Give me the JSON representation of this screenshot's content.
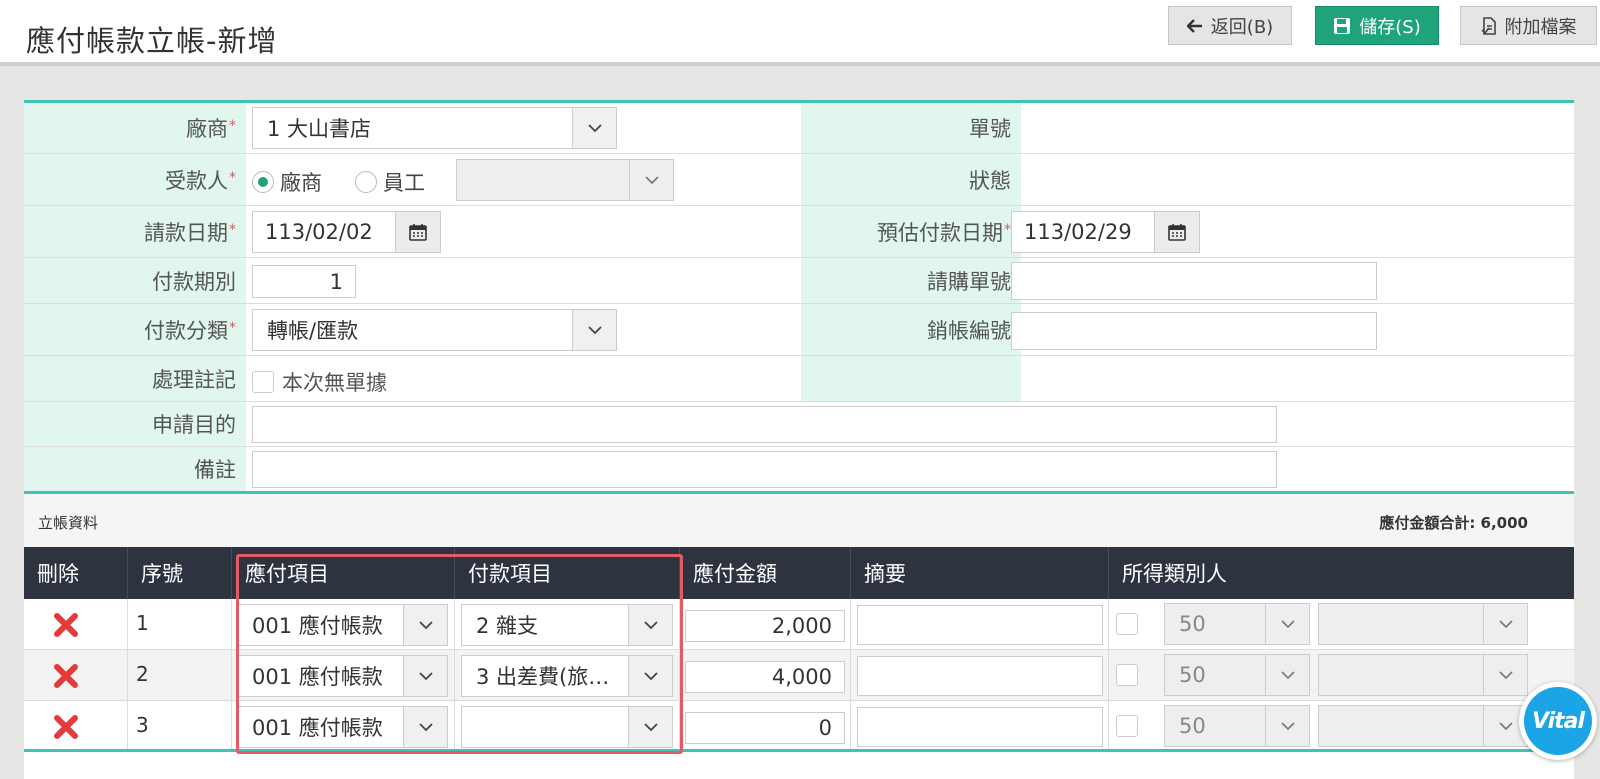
{
  "header": {
    "title": "應付帳款立帳-新增",
    "back_label": "返回(B)",
    "save_label": "儲存(S)",
    "attach_label": "附加檔案"
  },
  "form": {
    "vendor_label": "廠商",
    "vendor_value": "1 大山書店",
    "order_no_label": "單號",
    "payee_label": "受款人",
    "payee_opt_vendor": "廠商",
    "payee_opt_employee": "員工",
    "status_label": "狀態",
    "request_date_label": "請款日期",
    "request_date_value": "113/02/02",
    "est_pay_date_label": "預估付款日期",
    "est_pay_date_value": "113/02/29",
    "period_label": "付款期別",
    "period_value": "1",
    "purchase_no_label": "請購單號",
    "pay_category_label": "付款分類",
    "pay_category_value": "轉帳/匯款",
    "writeoff_no_label": "銷帳編號",
    "note_mark_label": "處理註記",
    "no_receipt_label": "本次無單據",
    "purpose_label": "申請目的",
    "remark_label": "備註",
    "required_mark": "*"
  },
  "section": {
    "title": "立帳資料",
    "total_text": "應付金額合計: 6,000"
  },
  "table": {
    "headers": [
      "刪除",
      "序號",
      "應付項目",
      "付款項目",
      "應付金額",
      "摘要",
      "所得類別人"
    ],
    "rows": [
      {
        "seq": "1",
        "item": "001 應付帳款",
        "pay_item": "2 雜支",
        "amount": "2,000",
        "income": "50"
      },
      {
        "seq": "2",
        "item": "001 應付帳款",
        "pay_item": "3 出差費(旅…",
        "amount": "4,000",
        "income": "50"
      },
      {
        "seq": "3",
        "item": "001 應付帳款",
        "pay_item": "",
        "amount": "0",
        "income": "50"
      }
    ]
  },
  "widget": {
    "label": "Vital"
  },
  "icons": {
    "back": "arrow-left-icon",
    "save": "floppy-disk-icon",
    "attach": "attachment-icon",
    "calendar": "calendar-icon",
    "chevron": "chevron-down-icon",
    "delete": "x-icon"
  },
  "colors": {
    "accent": "#1fa37a",
    "teal_border": "#3fc4b4",
    "label_bg": "#e0f6ef",
    "header_dark": "#2e3340",
    "delete_red": "#e23b3b",
    "highlight": "#e25b67"
  }
}
